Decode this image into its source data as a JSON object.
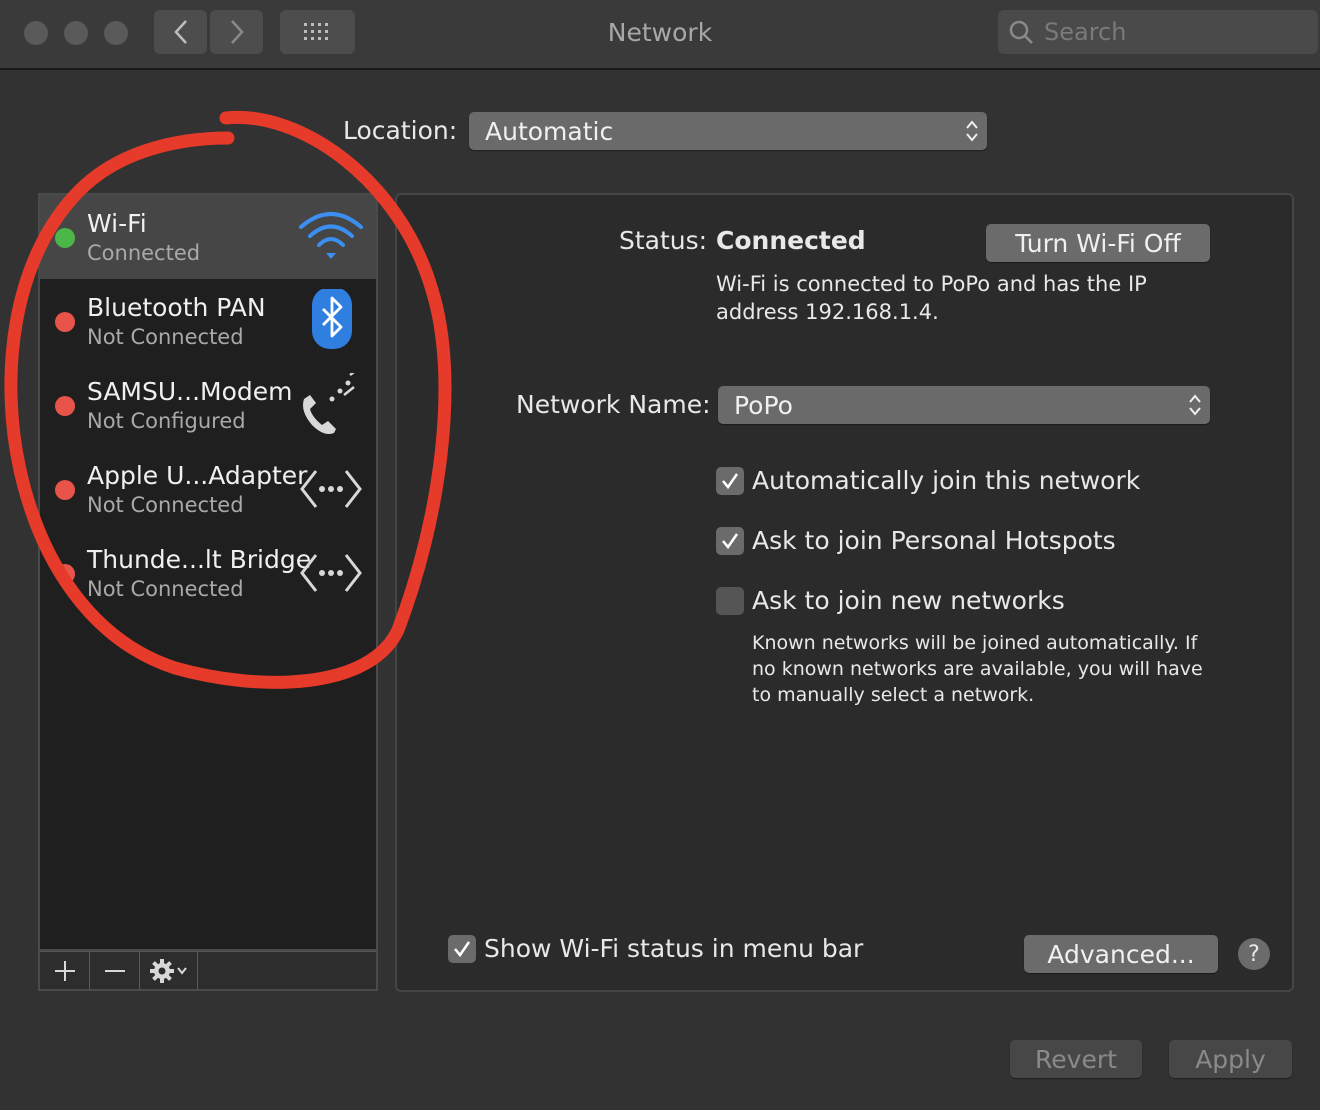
{
  "window": {
    "title": "Network",
    "search_placeholder": "Search"
  },
  "location": {
    "label": "Location:",
    "value": "Automatic"
  },
  "services": [
    {
      "name": "Wi-Fi",
      "status": "Connected",
      "status_color": "#4cb648",
      "icon": "wifi-icon",
      "selected": true
    },
    {
      "name": "Bluetooth PAN",
      "status": "Not Connected",
      "status_color": "#e8534a",
      "icon": "bluetooth-icon"
    },
    {
      "name": "SAMSU...Modem",
      "status": "Not Configured",
      "status_color": "#e8534a",
      "icon": "phone-icon"
    },
    {
      "name": "Apple U...Adapter",
      "status": "Not Connected",
      "status_color": "#e8534a",
      "icon": "ethernet-icon"
    },
    {
      "name": "Thunde...lt Bridge",
      "status": "Not Connected",
      "status_color": "#e8534a",
      "icon": "ethernet-icon"
    }
  ],
  "sidebar_toolbar": {
    "add_icon": "plus-icon",
    "remove_icon": "minus-icon",
    "actions_icon": "gear-icon"
  },
  "detail": {
    "status_label": "Status:",
    "status_value": "Connected",
    "toggle_button": "Turn Wi-Fi Off",
    "status_info": "Wi-Fi is connected to PoPo and has the IP address 192.168.1.4.",
    "network_name_label": "Network Name:",
    "network_name_value": "PoPo",
    "options": [
      {
        "label": "Automatically join this network",
        "checked": true
      },
      {
        "label": "Ask to join Personal Hotspots",
        "checked": true
      },
      {
        "label": "Ask to join new networks",
        "checked": false
      }
    ],
    "note": "Known networks will be joined automatically. If no known networks are available, you will have to manually select a network.",
    "show_status_label": "Show Wi-Fi status in menu bar",
    "show_status_checked": true,
    "advanced_button": "Advanced...",
    "help_button": "?"
  },
  "footer": {
    "revert_button": "Revert",
    "apply_button": "Apply"
  },
  "colors": {
    "accent_annotation": "#e63a2a",
    "connected": "#4cb648",
    "disconnected": "#e8534a"
  }
}
